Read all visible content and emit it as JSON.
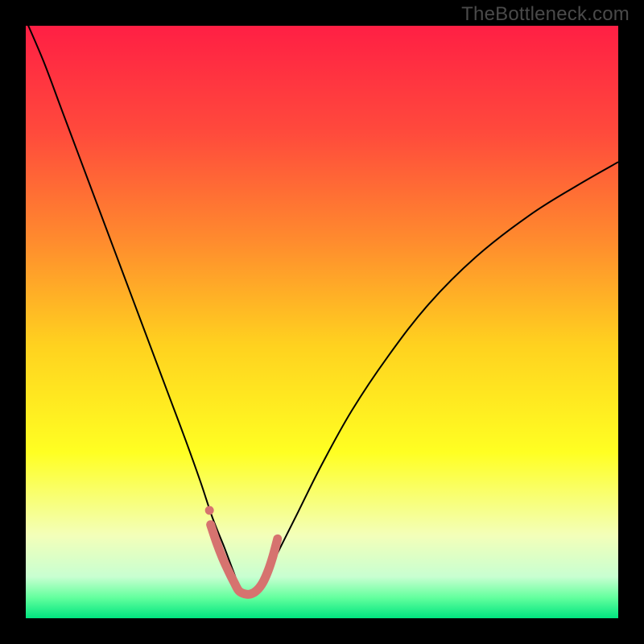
{
  "watermark": "TheBottleneck.com",
  "chart_data": {
    "type": "line",
    "title": "",
    "xlabel": "",
    "ylabel": "",
    "xlim": [
      0,
      100
    ],
    "ylim": [
      0,
      100
    ],
    "gradient": {
      "stops": [
        {
          "pos": 0.0,
          "color": "#ff1f44"
        },
        {
          "pos": 0.18,
          "color": "#ff4a3c"
        },
        {
          "pos": 0.36,
          "color": "#ff8a2e"
        },
        {
          "pos": 0.54,
          "color": "#ffd21f"
        },
        {
          "pos": 0.72,
          "color": "#ffff22"
        },
        {
          "pos": 0.86,
          "color": "#f3ffb9"
        },
        {
          "pos": 0.93,
          "color": "#c8ffd1"
        },
        {
          "pos": 0.965,
          "color": "#64ff9e"
        },
        {
          "pos": 1.0,
          "color": "#00e57f"
        }
      ]
    },
    "series": [
      {
        "name": "main-curve",
        "color": "#000000",
        "width": 2,
        "x": [
          0,
          3,
          6,
          9,
          12,
          15,
          18,
          21,
          24,
          27,
          29.5,
          31.5,
          33.5,
          35,
          36,
          37,
          38,
          39.5,
          41,
          43,
          46,
          50,
          55,
          61,
          68,
          76,
          85,
          93,
          100
        ],
        "y": [
          101,
          94,
          86,
          78,
          70,
          62,
          54,
          46,
          38,
          30,
          23,
          17,
          12,
          8,
          5.5,
          4.2,
          4.2,
          5.5,
          8,
          12,
          18,
          26,
          35,
          44,
          53,
          61,
          68,
          73,
          77
        ]
      },
      {
        "name": "trough-overlay",
        "color": "#d6736f",
        "width": 11,
        "linecap": "round",
        "x": [
          31.2,
          32.2,
          33.2,
          34.2,
          35.2,
          36.0,
          37.0,
          38.0,
          39.0,
          40.0,
          40.9,
          41.7,
          42.5
        ],
        "y": [
          15.8,
          12.8,
          10.2,
          8.0,
          6.0,
          4.6,
          4.1,
          4.1,
          4.7,
          6.0,
          8.0,
          10.4,
          13.4
        ]
      }
    ],
    "markers": [
      {
        "name": "trough-marker",
        "x": 31.0,
        "y": 18.2,
        "r": 5.5,
        "color": "#d6736f"
      }
    ]
  }
}
